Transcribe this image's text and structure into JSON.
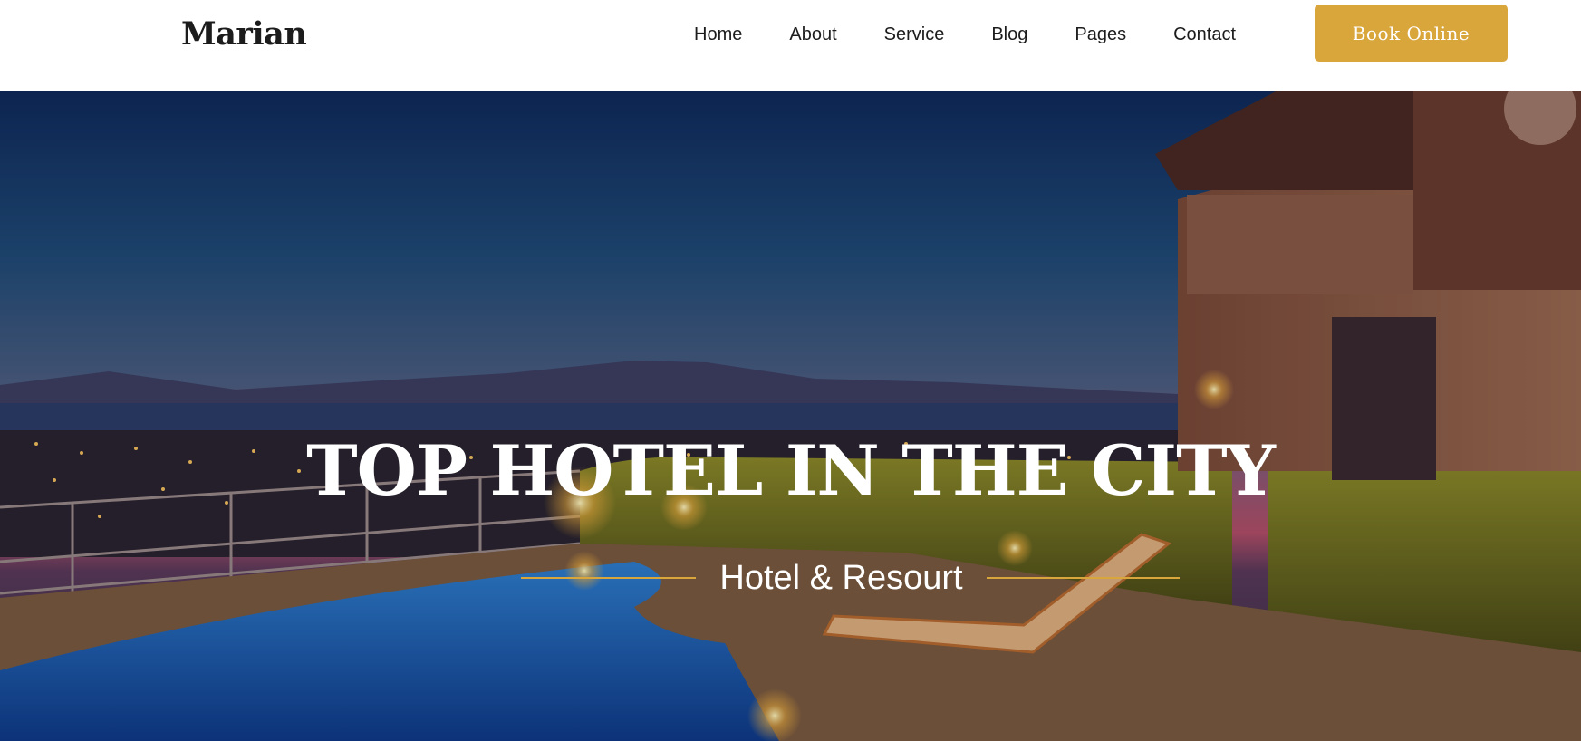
{
  "header": {
    "logo": "Marian",
    "nav": [
      {
        "label": "Home"
      },
      {
        "label": "About"
      },
      {
        "label": "Service"
      },
      {
        "label": "Blog"
      },
      {
        "label": "Pages"
      },
      {
        "label": "Contact"
      }
    ],
    "cta_label": "Book Online"
  },
  "hero": {
    "title": "TOP HOTEL IN THE CITY",
    "subtitle": "Hotel & Resourt",
    "background_image": "hotel-pool-at-dusk-photo"
  },
  "colors": {
    "accent": "#d9a63c",
    "text_dark": "#1c1c1c",
    "white": "#ffffff"
  }
}
